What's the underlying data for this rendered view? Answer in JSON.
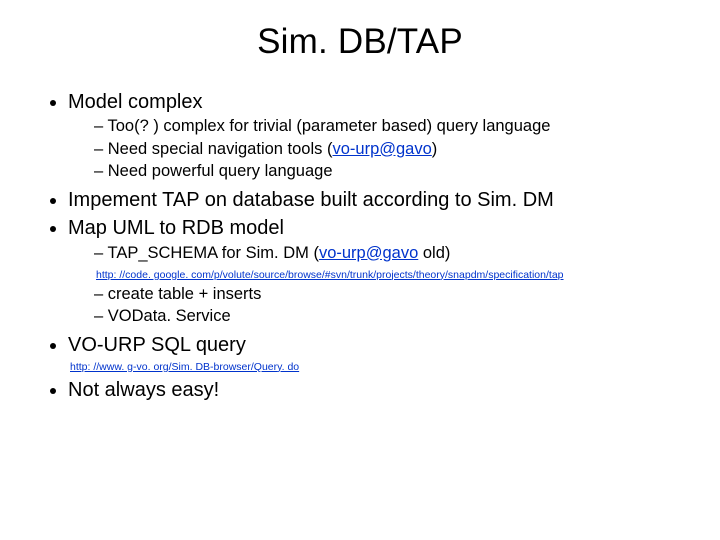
{
  "title": "Sim. DB/TAP",
  "b1": {
    "label": "Model complex",
    "s1": "Too(? ) complex for trivial (parameter based) query language",
    "s2_pre": "Need special navigation tools (",
    "s2_link": "vo-urp@gavo",
    "s2_post": ")",
    "s3": "Need powerful query language"
  },
  "b2": {
    "label": "Impement TAP on database built according to Sim. DM"
  },
  "b3": {
    "label": "Map UML to RDB model",
    "s1_pre": "TAP_SCHEMA for Sim. DM (",
    "s1_link": "vo-urp@gavo",
    "s1_post": " old)",
    "url": "http: //code. google. com/p/volute/source/browse/#svn/trunk/projects/theory/snapdm/specification/tap",
    "s2": "create table + inserts",
    "s3": "VOData. Service"
  },
  "b4": {
    "label": "VO-URP SQL query",
    "url": "http: //www. g-vo. org/Sim. DB-browser/Query. do"
  },
  "b5": {
    "label": "Not always easy!"
  }
}
